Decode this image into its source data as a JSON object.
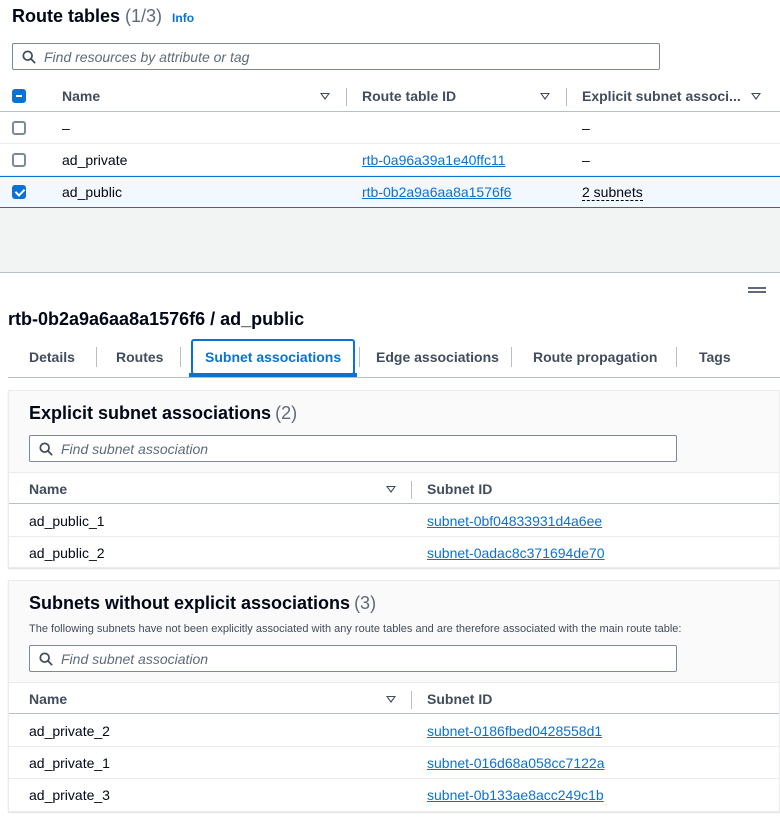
{
  "route_tables": {
    "title": "Route tables",
    "count": "(1/3)",
    "info": "Info",
    "search_placeholder": "Find resources by attribute or tag",
    "columns": {
      "name": "Name",
      "id": "Route table ID",
      "explicit": "Explicit subnet associ..."
    },
    "rows": [
      {
        "name": "–",
        "id": "",
        "explicit": "–",
        "checked": false
      },
      {
        "name": "ad_private",
        "id": "rtb-0a96a39a1e40ffc11",
        "explicit": "–",
        "checked": false
      },
      {
        "name": "ad_public",
        "id": "rtb-0b2a9a6aa8a1576f6",
        "explicit": "2 subnets",
        "checked": true
      }
    ]
  },
  "detail": {
    "title": "rtb-0b2a9a6aa8a1576f6 / ad_public",
    "tabs": [
      "Details",
      "Routes",
      "Subnet associations",
      "Edge associations",
      "Route propagation",
      "Tags"
    ],
    "active_tab": "Subnet associations"
  },
  "explicit_panel": {
    "title": "Explicit subnet associations",
    "count": "(2)",
    "search_placeholder": "Find subnet association",
    "columns": {
      "name": "Name",
      "subnet": "Subnet ID"
    },
    "rows": [
      {
        "name": "ad_public_1",
        "subnet": "subnet-0bf04833931d4a6ee"
      },
      {
        "name": "ad_public_2",
        "subnet": "subnet-0adac8c371694de70"
      }
    ]
  },
  "implicit_panel": {
    "title": "Subnets without explicit associations",
    "count": "(3)",
    "description": "The following subnets have not been explicitly associated with any route tables and are therefore associated with the main route table:",
    "search_placeholder": "Find subnet association",
    "columns": {
      "name": "Name",
      "subnet": "Subnet ID"
    },
    "rows": [
      {
        "name": "ad_private_2",
        "subnet": "subnet-0186fbed0428558d1"
      },
      {
        "name": "ad_private_1",
        "subnet": "subnet-016d68a058cc7122a"
      },
      {
        "name": "ad_private_3",
        "subnet": "subnet-0b133ae8acc249c1b"
      }
    ]
  },
  "colors": {
    "link": "#0972d3",
    "text": "#000716",
    "muted": "#5f6b7a",
    "selected_bg": "#f2f8fd"
  }
}
